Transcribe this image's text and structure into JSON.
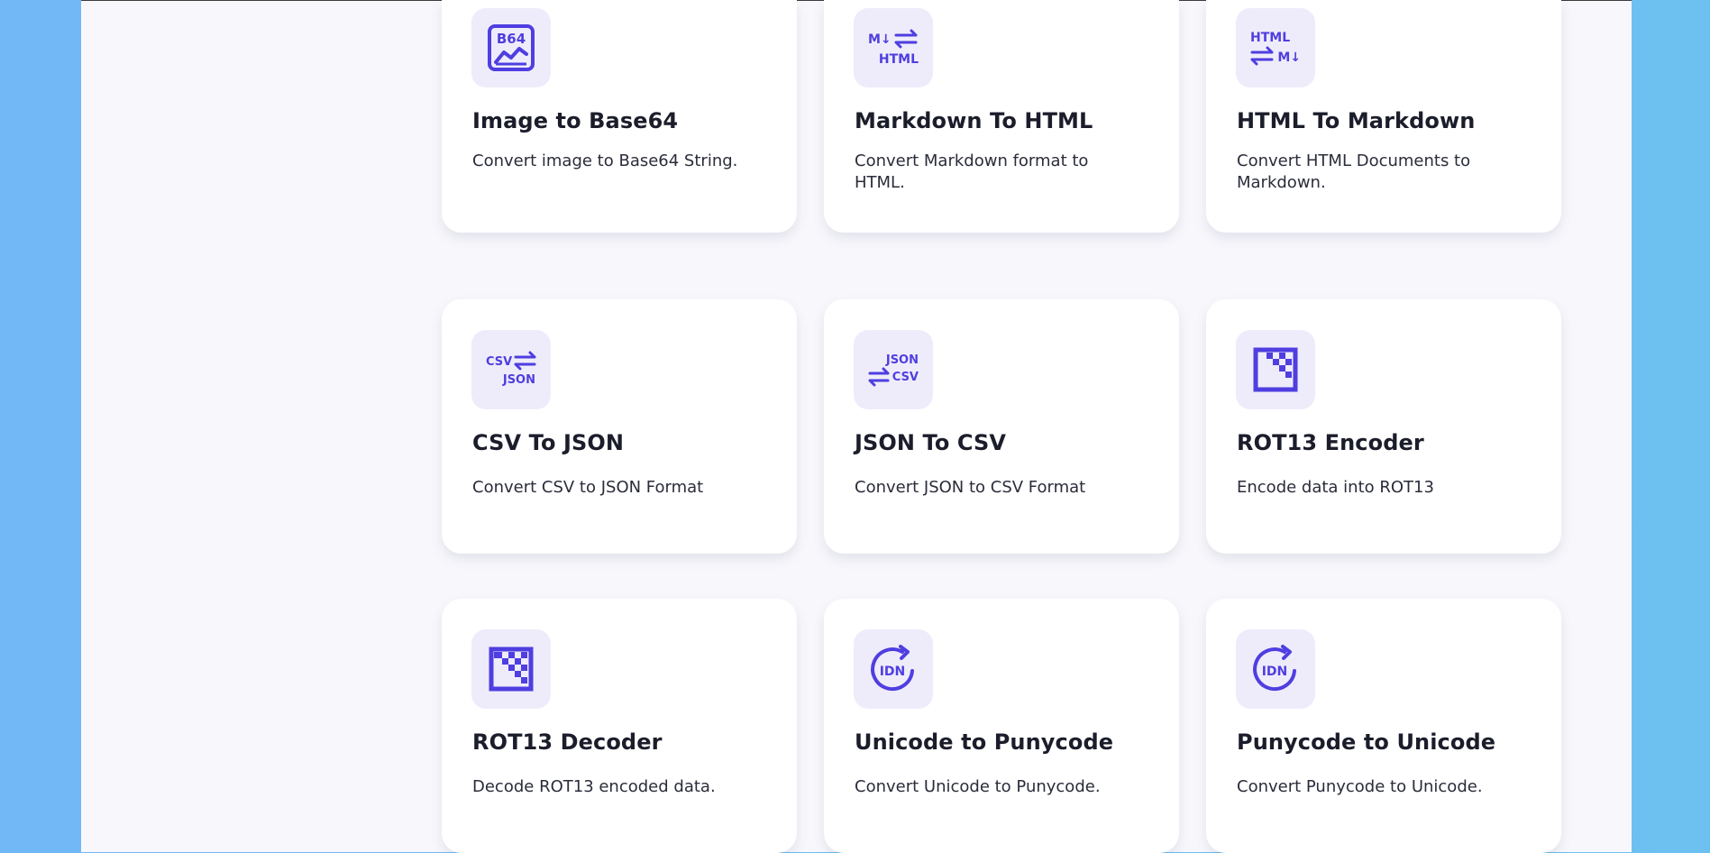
{
  "accent_color": "#4f3ee0",
  "icon_bg_color": "#eeecfb",
  "tools": [
    {
      "title": "Image to Base64",
      "description": "Convert image to Base64 String.",
      "icon": "image-base64-icon",
      "icon_text": [
        "B64"
      ]
    },
    {
      "title": "Markdown To HTML",
      "description": "Convert Markdown format to HTML.",
      "icon": "markdown-to-html-icon",
      "icon_text": [
        "M↓",
        "HTML"
      ]
    },
    {
      "title": "HTML To Markdown",
      "description": "Convert HTML Documents to Markdown.",
      "icon": "html-to-markdown-icon",
      "icon_text": [
        "HTML",
        "M↓"
      ]
    },
    {
      "title": "CSV To JSON",
      "description": "Convert CSV to JSON Format",
      "icon": "csv-to-json-icon",
      "icon_text": [
        "CSV",
        "JSON"
      ]
    },
    {
      "title": "JSON To CSV",
      "description": "Convert JSON to CSV Format",
      "icon": "json-to-csv-icon",
      "icon_text": [
        "JSON",
        "CSV"
      ]
    },
    {
      "title": "ROT13 Encoder",
      "description": "Encode data into ROT13",
      "icon": "rot13-encoder-icon"
    },
    {
      "title": "ROT13 Decoder",
      "description": "Decode ROT13 encoded data.",
      "icon": "rot13-decoder-icon"
    },
    {
      "title": "Unicode to Punycode",
      "description": "Convert Unicode to Punycode.",
      "icon": "idn-convert-icon",
      "icon_text": [
        "IDN"
      ]
    },
    {
      "title": "Punycode to Unicode",
      "description": "Convert Punycode to Unicode.",
      "icon": "idn-convert-icon",
      "icon_text": [
        "IDN"
      ]
    }
  ]
}
